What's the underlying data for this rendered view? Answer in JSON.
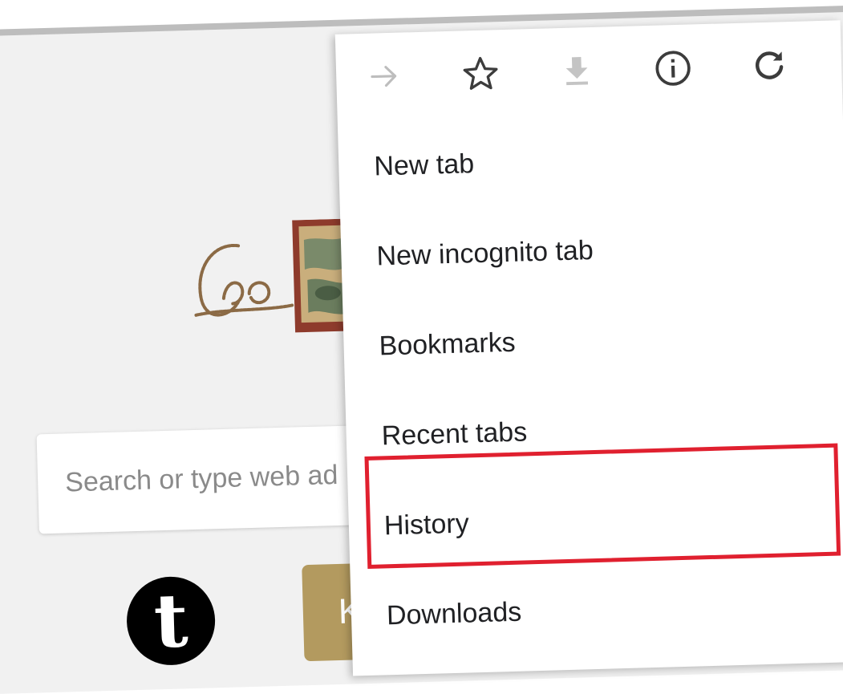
{
  "background": {
    "search": {
      "placeholder": "Search or type web ad"
    },
    "tiles": [
      {
        "letter": "t",
        "color": "#000000"
      },
      {
        "letter": "K",
        "color": "#b39a5f"
      }
    ]
  },
  "menu": {
    "toolbar": [
      {
        "icon": "forward-arrow-icon",
        "state": "disabled"
      },
      {
        "icon": "star-icon"
      },
      {
        "icon": "download-icon",
        "state": "disabled"
      },
      {
        "icon": "info-icon"
      },
      {
        "icon": "reload-icon"
      }
    ],
    "items": [
      {
        "label": "New tab"
      },
      {
        "label": "New incognito tab"
      },
      {
        "label": "Bookmarks"
      },
      {
        "label": "Recent tabs"
      },
      {
        "label": "History"
      },
      {
        "label": "Downloads"
      }
    ],
    "highlight": {
      "item": "History",
      "color": "#e0202f"
    }
  }
}
